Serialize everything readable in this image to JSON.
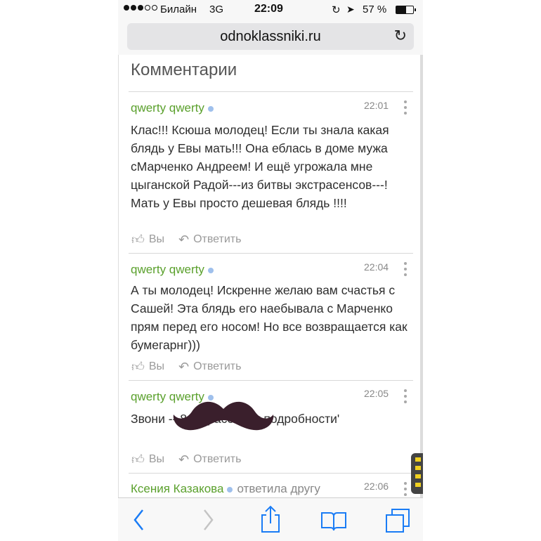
{
  "status_bar": {
    "carrier": "Билайн",
    "network": "3G",
    "time": "22:09",
    "battery_percent": "57 %",
    "battery_level": 0.57
  },
  "browser": {
    "url": "odnoklassniki.ru"
  },
  "page": {
    "heading": "Комментарии",
    "comments": [
      {
        "author": "qwerty qwerty",
        "time": "22:01",
        "text": "Клас!!!  Ксюша молодец! Если ты знала какая блядь у Евы мать!!! Она еблась в доме мужа сМарченко Андреем! И ещё угрожала мне цыганской Радой---из битвы экстрасенсов---!  Мать у Евы просто дешевая блядь !!!!",
        "like_label": "Вы",
        "reply_label": "Ответить"
      },
      {
        "author": "qwerty qwerty",
        "time": "22:04",
        "text": "А ты молодец! Искренне желаю вам счастья с Сашей! Эта блядь его наебывала с Марченко прям перед его носом! Но все возвращается как бумегарнг)))",
        "like_label": "Вы",
        "reply_label": "Ответить"
      },
      {
        "author": "qwerty qwerty",
        "time": "22:05",
        "text": "Звони -- 8 46 расскажу подробности'",
        "like_label": "Вы",
        "reply_label": "Ответить"
      },
      {
        "author": "Ксения Казакова",
        "reply_note": "ответила другу",
        "time": "22:06"
      }
    ]
  },
  "icons": {
    "back": "chevron-left-icon",
    "forward": "chevron-right-icon",
    "share": "share-icon",
    "bookmarks": "book-icon",
    "tabs": "tabs-icon",
    "reload": "reload-icon",
    "like": "thumbs-up-icon",
    "reply": "reply-arrow-icon"
  },
  "colors": {
    "author_green": "#5aa02c",
    "ios_blue": "#1a7cf5",
    "online_dot": "#9fc0ec"
  }
}
